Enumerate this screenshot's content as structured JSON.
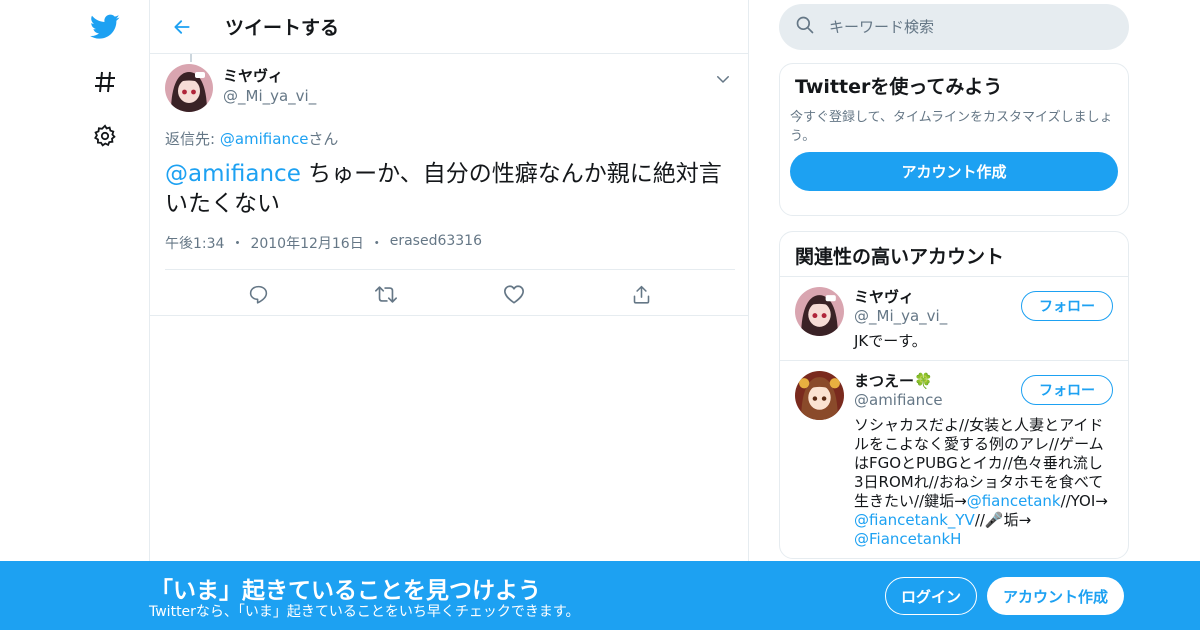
{
  "colors": {
    "accent": "#1da1f2",
    "secondary_text": "#657786",
    "border": "#e6ecf0"
  },
  "nav": {
    "icons": [
      "twitter-logo-icon",
      "hashtag-icon",
      "gear-icon"
    ]
  },
  "header": {
    "title": "ツイートする"
  },
  "tweet": {
    "display_name": "ミヤヴィ",
    "screen_name": "@_Mi_ya_vi_",
    "reply_prefix": "返信先: ",
    "reply_handle": "@amifiance",
    "reply_suffix": "さん",
    "mention": "@amifiance",
    "text": " ちゅーか、自分の性癖なんか親に絶対言いたくない",
    "time": "午後1:34",
    "date": "2010年12月16日",
    "source": "erased63316",
    "actions": [
      "reply-icon",
      "retweet-icon",
      "like-icon",
      "share-icon"
    ]
  },
  "search": {
    "placeholder": "キーワード検索"
  },
  "signup_card": {
    "title": "Twitterを使ってみよう",
    "description": "今すぐ登録して、タイムラインをカスタマイズしましょう。",
    "button": "アカウント作成"
  },
  "related": {
    "title": "関連性の高いアカウント",
    "accounts": [
      {
        "name": "ミヤヴィ",
        "handle": "@_Mi_ya_vi_",
        "bio": "JKでーす。",
        "follow": "フォロー"
      },
      {
        "name": "まつえー🍀",
        "handle": "@amifiance",
        "bio_1": "ソシャカスだよ//女装と人妻とアイドルをこよなく愛する例のアレ//ゲームはFGOとPUBGとイカ//色々垂れ流し3日ROMれ//おねショタホモを食べて生きたい//鍵垢→",
        "bio_link_1": "@fiancetank",
        "bio_2": "//YOI→",
        "bio_link_2": "@fiancetank_YV",
        "bio_3": "//🎤垢→",
        "bio_link_3": "@FiancetankH",
        "follow": "フォロー"
      }
    ]
  },
  "banner": {
    "title": "「いま」起きていることを見つけよう",
    "subtitle": "Twitterなら、「いま」起きていることをいち早くチェックできます。",
    "login": "ログイン",
    "signup": "アカウント作成"
  }
}
